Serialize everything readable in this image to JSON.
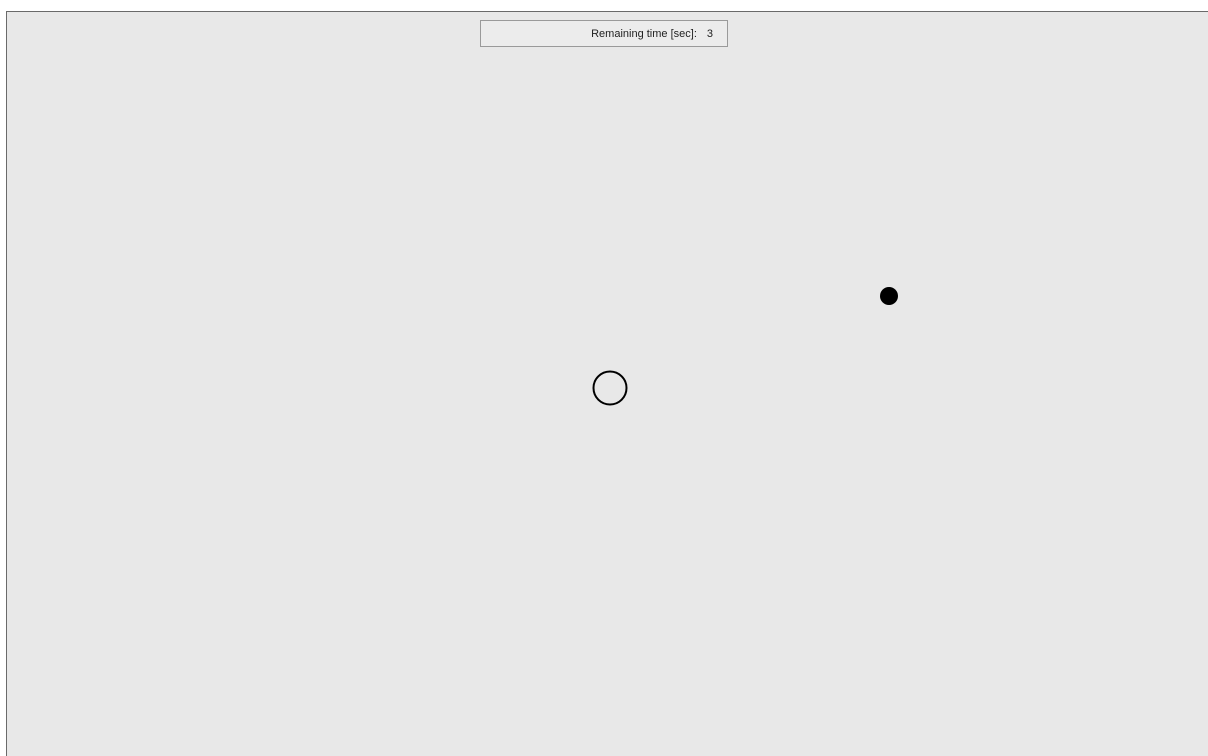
{
  "timer": {
    "label": "Remaining time [sec]:",
    "value": "3"
  },
  "colors": {
    "background": "#e8e8e8",
    "target_outline": "#000000",
    "cursor_fill": "#000000"
  },
  "icons": {
    "target": "target-ring-icon",
    "cursor": "cursor-dot-icon"
  }
}
